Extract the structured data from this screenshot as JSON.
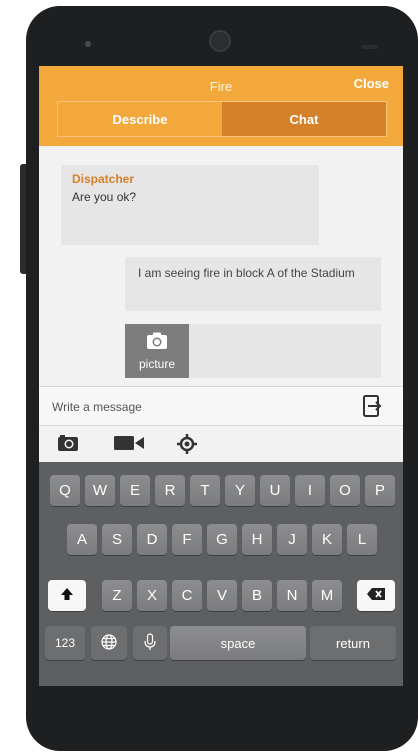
{
  "header": {
    "title": "Fire",
    "close_label": "Close"
  },
  "tabs": [
    {
      "label": "Describe",
      "active": false
    },
    {
      "label": "Chat",
      "active": true
    }
  ],
  "messages": [
    {
      "sender": "Dispatcher",
      "text": "Are you ok?"
    },
    {
      "text": "I am seeing fire in block A of the Stadium"
    },
    {
      "attachment_label": "picture"
    }
  ],
  "composer": {
    "placeholder": "Write a message"
  },
  "keyboard": {
    "row1": [
      "Q",
      "W",
      "E",
      "R",
      "T",
      "Y",
      "U",
      "I",
      "O",
      "P"
    ],
    "row2": [
      "A",
      "S",
      "D",
      "F",
      "G",
      "H",
      "J",
      "K",
      "L"
    ],
    "row3": [
      "Z",
      "X",
      "C",
      "V",
      "B",
      "N",
      "M"
    ],
    "numbers_label": "123",
    "space_label": "space",
    "return_label": "return"
  },
  "colors": {
    "accent": "#f2a83a",
    "accent_dark": "#d4812a"
  }
}
